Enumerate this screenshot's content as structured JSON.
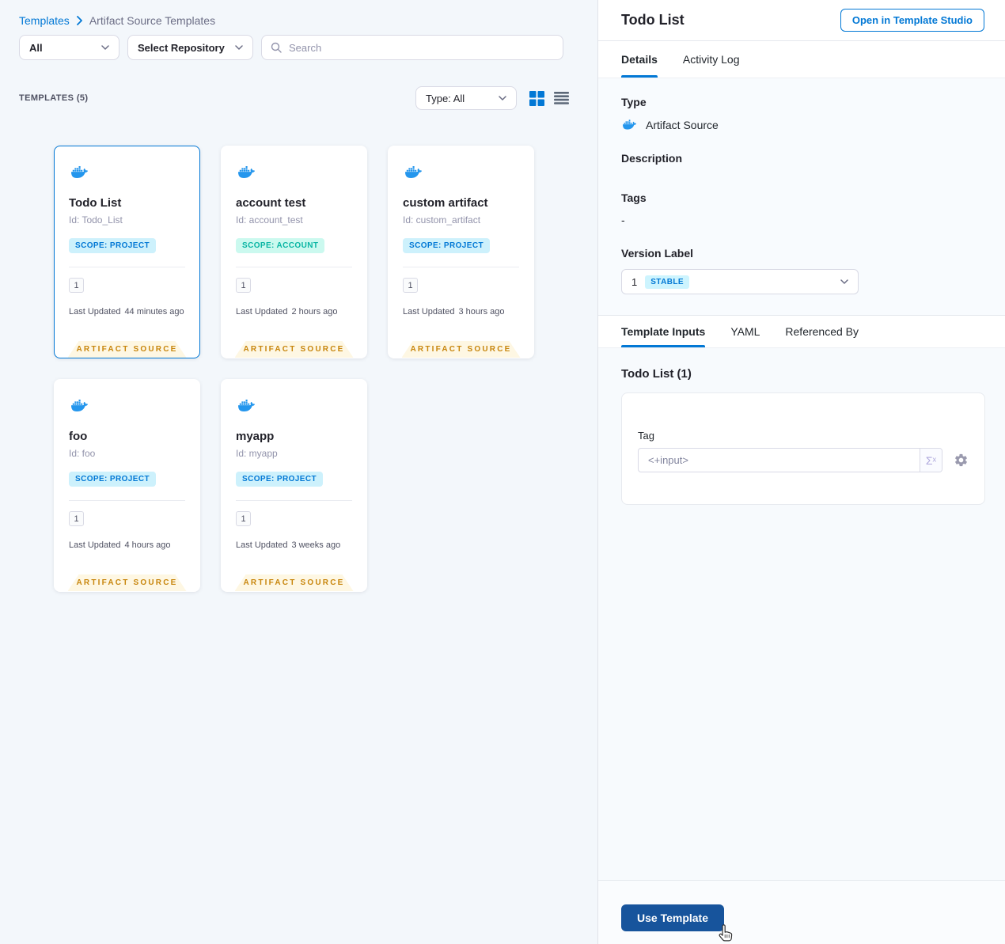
{
  "breadcrumb": {
    "link": "Templates",
    "current": "Artifact Source Templates"
  },
  "filters": {
    "scope_dropdown": "All",
    "repo_dropdown": "Select Repository",
    "search_placeholder": "Search"
  },
  "list_header": {
    "count_label": "TEMPLATES (5)",
    "type_dropdown": "Type: All"
  },
  "cards": [
    {
      "title": "Todo List",
      "id": "Id: Todo_List",
      "scope": "SCOPE: PROJECT",
      "version": "1",
      "updated_label": "Last Updated",
      "updated": "44 minutes ago",
      "ribbon": "ARTIFACT SOURCE"
    },
    {
      "title": "account test",
      "id": "Id: account_test",
      "scope": "SCOPE: ACCOUNT",
      "version": "1",
      "updated_label": "Last Updated",
      "updated": "2 hours ago",
      "ribbon": "ARTIFACT SOURCE"
    },
    {
      "title": "custom artifact",
      "id": "Id: custom_artifact",
      "scope": "SCOPE: PROJECT",
      "version": "1",
      "updated_label": "Last Updated",
      "updated": "3 hours ago",
      "ribbon": "ARTIFACT SOURCE"
    },
    {
      "title": "foo",
      "id": "Id: foo",
      "scope": "SCOPE: PROJECT",
      "version": "1",
      "updated_label": "Last Updated",
      "updated": "4 hours ago",
      "ribbon": "ARTIFACT SOURCE"
    },
    {
      "title": "myapp",
      "id": "Id: myapp",
      "scope": "SCOPE: PROJECT",
      "version": "1",
      "updated_label": "Last Updated",
      "updated": "3 weeks ago",
      "ribbon": "ARTIFACT SOURCE"
    }
  ],
  "detail": {
    "title": "Todo List",
    "open_studio_button": "Open in Template Studio",
    "tabs": {
      "details": "Details",
      "activity_log": "Activity Log"
    },
    "type_label": "Type",
    "type_value": "Artifact Source",
    "description_label": "Description",
    "tags_label": "Tags",
    "tags_value": "-",
    "version_label": "Version Label",
    "version_value": "1",
    "version_badge": "STABLE",
    "inputs_tabs": {
      "template_inputs": "Template Inputs",
      "yaml": "YAML",
      "referenced_by": "Referenced By"
    },
    "inputs_heading": "Todo List (1)",
    "tag_field": {
      "label": "Tag",
      "value": "<+input>",
      "expression_symbol": "Σˣ"
    },
    "use_template_button": "Use Template"
  },
  "colors": {
    "primary_blue": "#0278D5",
    "button_blue": "#17549C",
    "docker_blue": "#2496ED",
    "ribbon_bg": "#FEF7E3",
    "ribbon_text": "#C8860D",
    "scope_project_bg": "#CDF1FC",
    "scope_account_bg": "#CBF9EF",
    "scope_account_text": "#09B5A3",
    "stable_badge_bg": "#CDF4FE"
  }
}
